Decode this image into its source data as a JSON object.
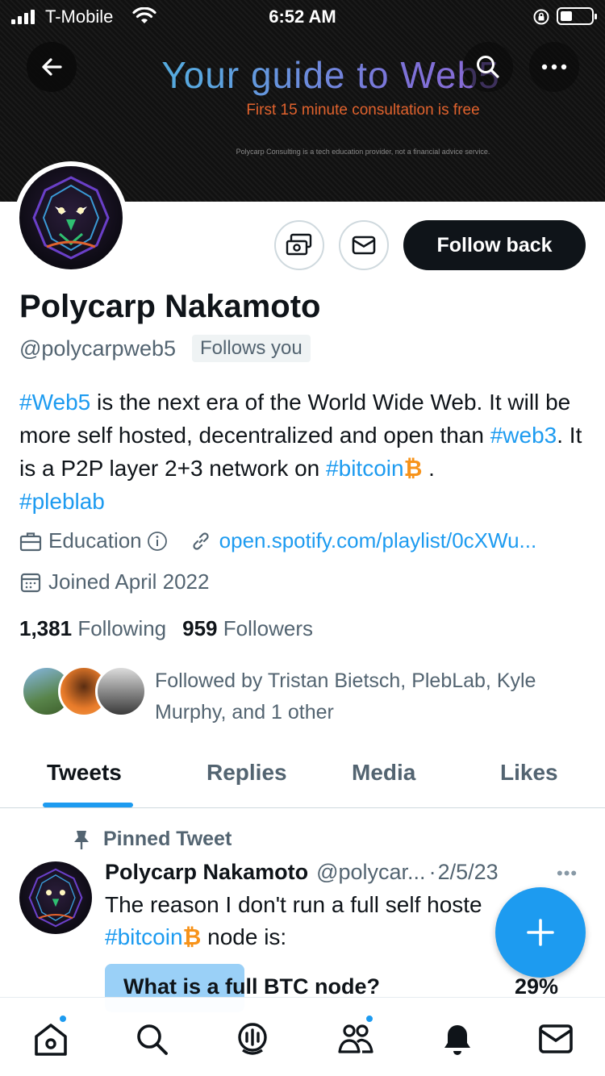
{
  "status_bar": {
    "carrier": "T-Mobile",
    "time": "6:52 AM"
  },
  "banner": {
    "headline": "Your guide to Web5",
    "subline": "First 15 minute consultation is free",
    "fineprint": "Polycarp Consulting is a tech education provider, not a financial advice service."
  },
  "profile": {
    "name": "Polycarp Nakamoto",
    "handle": "@polycarpweb5",
    "follows_you": "Follows you",
    "follow_button": "Follow back",
    "bio": {
      "t1": "#Web5",
      "t2": " is the next era of the World Wide Web. It will be more self hosted, decentralized and open than ",
      "t3": "#web3",
      "t4": ". It is a P2P layer 2+3 network on ",
      "t5": "#bitcoin",
      "t6": " . ",
      "t7": "#pleblab"
    },
    "category": "Education",
    "link": "open.spotify.com/playlist/0cXWu...",
    "joined": "Joined April 2022",
    "following_count": "1,381",
    "following_label": "Following",
    "followers_count": "959",
    "followers_label": "Followers",
    "followed_by": "Followed by Tristan Bietsch, PlebLab, Kyle Murphy, and 1 other"
  },
  "tabs": [
    "Tweets",
    "Replies",
    "Media",
    "Likes"
  ],
  "pinned_tweet": {
    "pinned_label": "Pinned Tweet",
    "author": "Polycarp Nakamoto",
    "handle": "@polycar...",
    "date": "2/5/23",
    "text1": "The reason I don't run a full self hoste",
    "text2": "#bitcoin",
    "text3": " node is:",
    "poll_option": "What is a full BTC node?",
    "poll_pct": "29%",
    "poll_fraction": 0.29
  },
  "colors": {
    "accent": "#1d9bf0",
    "bitcoin": "#f7931a",
    "text": "#0f1419",
    "muted": "#536471"
  }
}
